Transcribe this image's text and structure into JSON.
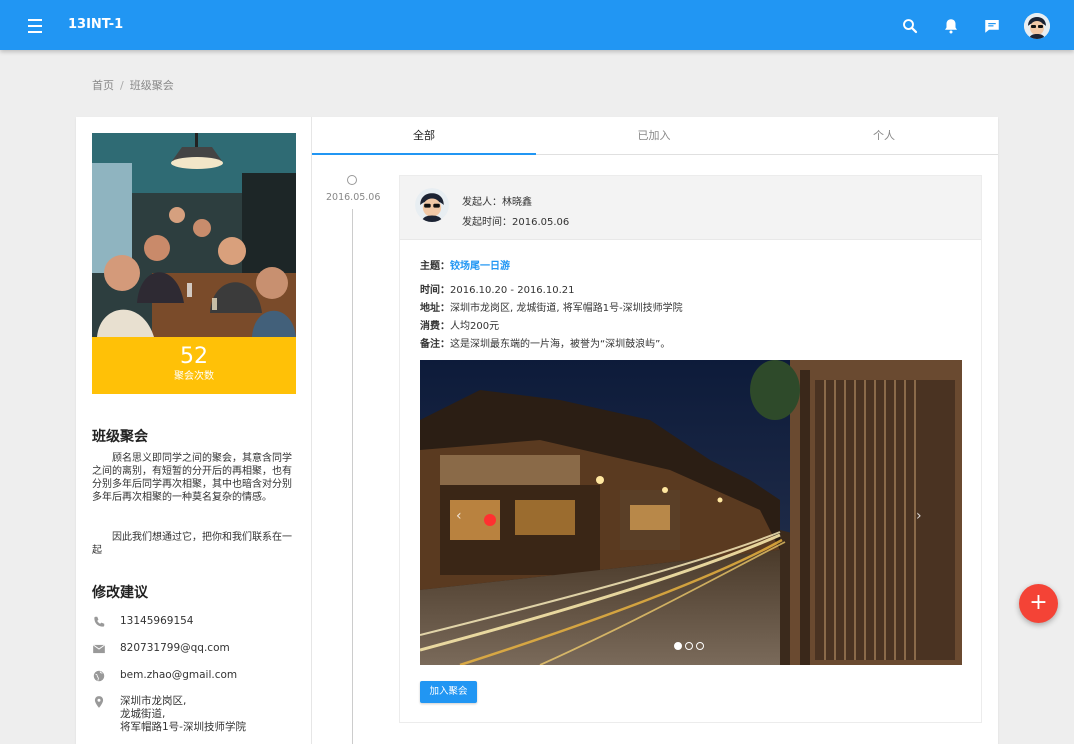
{
  "app": {
    "title": "13INT-1"
  },
  "header": {
    "icons": [
      "search-icon",
      "notification-icon",
      "message-icon",
      "user-avatar"
    ]
  },
  "breadcrumb": {
    "home": "首页",
    "separator": "/",
    "current": "班级聚会"
  },
  "stats": {
    "count": "52",
    "label": "聚会次数"
  },
  "about": {
    "title": "班级聚会",
    "paragraph1": "顾名思义即同学之间的聚会，其意含同学之间的离别，有短暂的分开后的再相聚，也有分别多年后同学再次相聚，其中也暗含对分别多年后再次相聚的一种莫名复杂的情感。",
    "paragraph2": "因此我们想通过它，把你和我们联系在一起"
  },
  "suggest": {
    "title": "修改建议",
    "phone": "13145969154",
    "qq_email": "820731799@qq.com",
    "gmail": "bem.zhao@gmail.com",
    "address_line1": "深圳市龙岗区,",
    "address_line2": "龙城街道,",
    "address_line3": "将军帽路1号-深圳技师学院"
  },
  "tabs": [
    {
      "label": "全部",
      "active": true
    },
    {
      "label": "已加入",
      "active": false
    },
    {
      "label": "个人",
      "active": false
    }
  ],
  "timeline": {
    "date": "2016.05.06"
  },
  "event": {
    "organizer_label": "发起人：",
    "organizer": "林晓鑫",
    "time_label": "发起时间：",
    "created": "2016.05.06",
    "topic_label": "主题：",
    "topic": "铰场尾一日游",
    "when_label": "时间：",
    "when": "2016.10.20 - 2016.10.21",
    "address_label": "地址：",
    "address": "深圳市龙岗区, 龙城街道, 将军帽路1号-深圳技师学院",
    "cost_label": "消费：",
    "cost": "人均200元",
    "note_label": "备注：",
    "note": "这是深圳最东端的一片海，被誉为“深圳鼓浪屿”。",
    "carousel": {
      "slides": 3,
      "active_slide": 1
    },
    "join_label": "加入聚会"
  },
  "fab": {
    "label": "+"
  },
  "colors": {
    "primary": "#2196f3",
    "accent": "#ffc107",
    "fab": "#f44336"
  }
}
